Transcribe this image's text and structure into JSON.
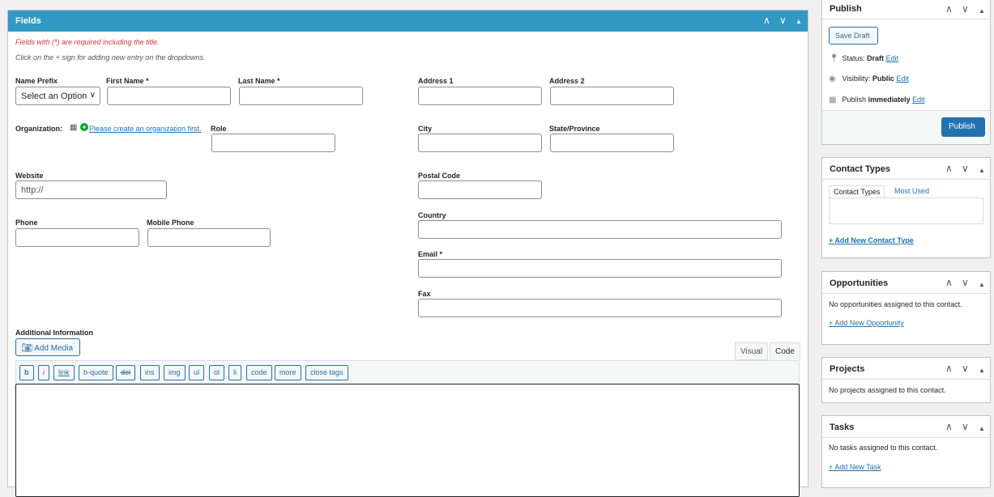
{
  "fields_panel": {
    "title": "Fields",
    "required_note": "Fields with (*) are required including the title.",
    "dropdown_note": "Click on the + sign for adding new entry on the dropdowns.",
    "labels": {
      "name_prefix": "Name Prefix",
      "first_name": "First Name *",
      "last_name": "Last Name *",
      "address1": "Address 1",
      "address2": "Address 2",
      "organization": "Organization:",
      "role": "Role",
      "city": "City",
      "state": "State/Province",
      "website": "Website",
      "postal_code": "Postal Code",
      "phone": "Phone",
      "mobile_phone": "Mobile Phone",
      "country": "Country",
      "email": "Email *",
      "fax": "Fax",
      "additional_info": "Additional Information"
    },
    "name_prefix_selected": "Select an Option",
    "organization_link": "Please create an organization first.",
    "website_placeholder": "http://",
    "add_media_label": "Add Media",
    "editor_tabs": [
      "Visual",
      "Code"
    ],
    "quicktags": [
      "b",
      "i",
      "link",
      "b-quote",
      "del",
      "ins",
      "img",
      "ul",
      "ol",
      "li",
      "code",
      "more",
      "close tags"
    ]
  },
  "sidebar": {
    "publish": {
      "title": "Publish",
      "save_draft": "Save Draft",
      "status_label": "Status:",
      "status_value": "Draft",
      "visibility_label": "Visibility:",
      "visibility_value": "Public",
      "publish_label": "Publish",
      "publish_value": "immediately",
      "edit": "Edit",
      "publish_button": "Publish"
    },
    "contact_types": {
      "title": "Contact Types",
      "tab_all": "Contact Types",
      "tab_most_used": "Most Used",
      "add_link": "+ Add New Contact Type"
    },
    "opportunities": {
      "title": "Opportunities",
      "empty": "No opportunities assigned to this contact.",
      "add_link": "+ Add New Opportunity"
    },
    "projects": {
      "title": "Projects",
      "empty": "No projects assigned to this contact."
    },
    "tasks": {
      "title": "Tasks",
      "empty": "No tasks assigned to this contact.",
      "add_link": "+ Add New Task"
    }
  },
  "colors": {
    "header_blue": "#3299c4",
    "link_blue": "#2271b1",
    "required_red": "#d63638",
    "background": "#f0f0f1"
  }
}
